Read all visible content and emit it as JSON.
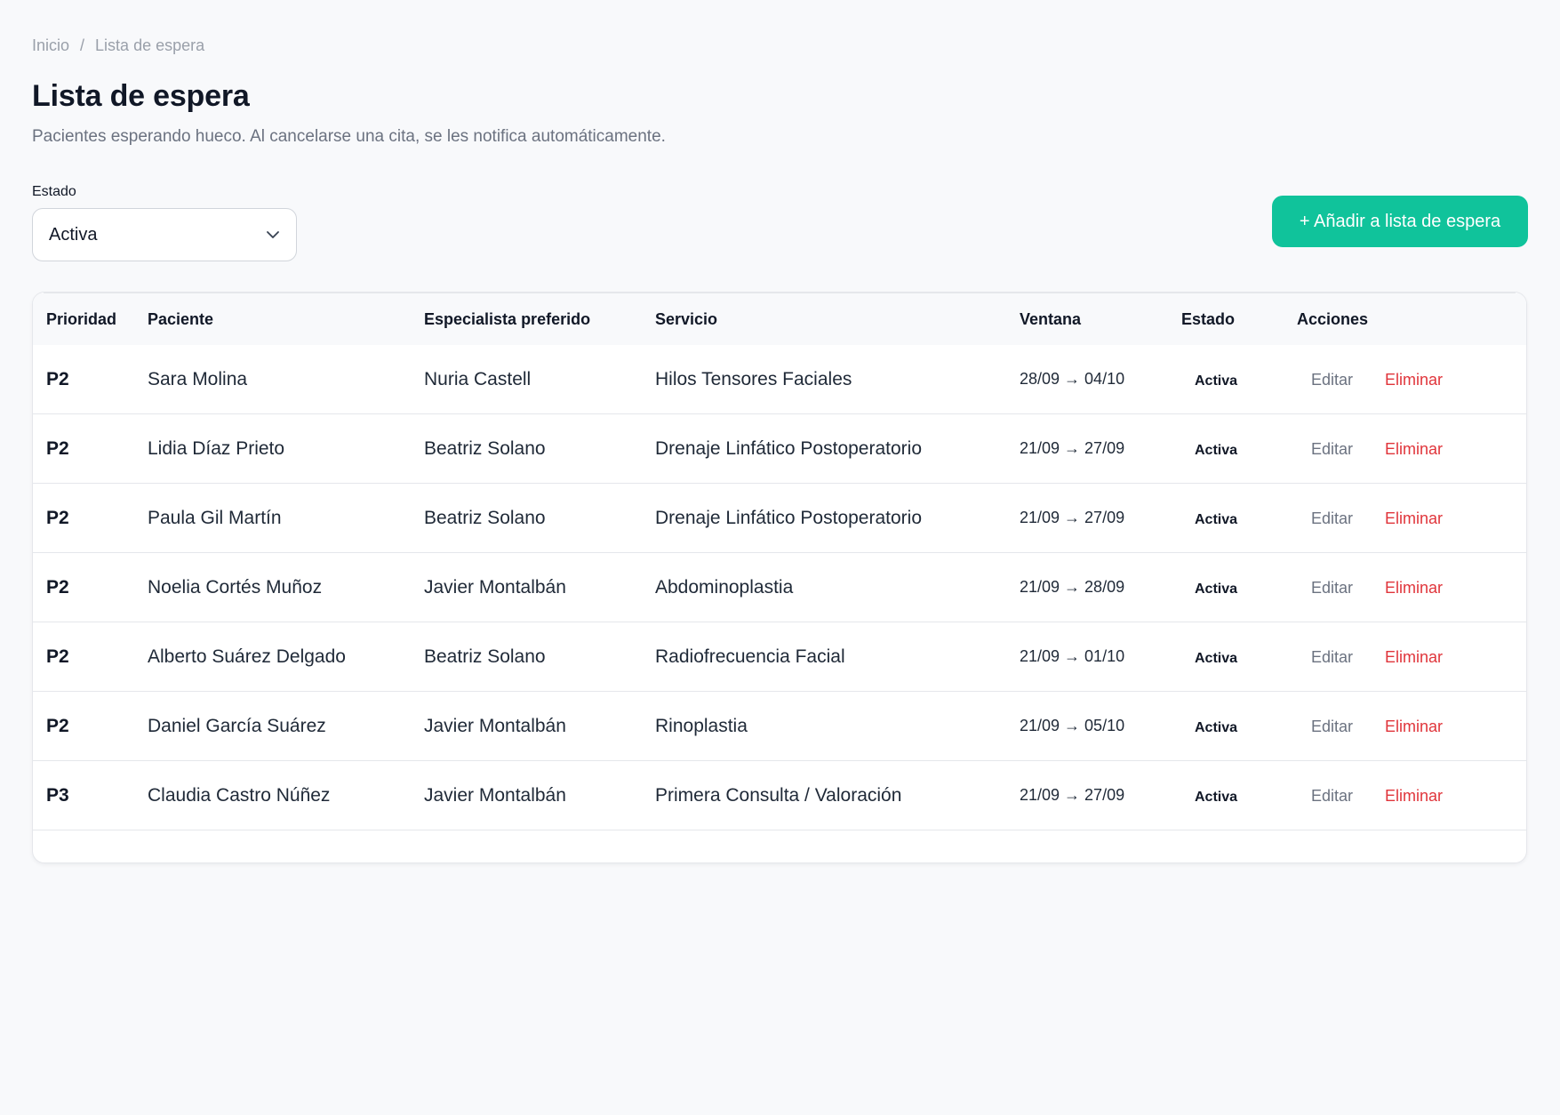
{
  "breadcrumb": {
    "home": "Inicio",
    "separator": "/",
    "current": "Lista de espera"
  },
  "page": {
    "title": "Lista de espera",
    "subtitle": "Pacientes esperando hueco. Al cancelarse una cita, se les notifica automáticamente."
  },
  "filter": {
    "label": "Estado",
    "selected": "Activa",
    "icon": "chevron-down-icon"
  },
  "add_button": {
    "label": "+ Añadir a lista de espera",
    "color": "#10c39b"
  },
  "table": {
    "columns": [
      "Prioridad",
      "Paciente",
      "Especialista preferido",
      "Servicio",
      "Ventana",
      "Estado",
      "Acciones"
    ],
    "rows": [
      {
        "priority": "P2",
        "patient": "Sara Molina",
        "specialist": "Nuria Castell",
        "service": "Hilos Tensores Faciales",
        "window": "28/09 → 04/10",
        "status": "Activa",
        "edit": "Editar",
        "delete": "Eliminar"
      },
      {
        "priority": "P2",
        "patient": "Lidia Díaz Prieto",
        "specialist": "Beatriz Solano",
        "service": "Drenaje Linfático Postoperatorio",
        "window": "21/09 → 27/09",
        "status": "Activa",
        "edit": "Editar",
        "delete": "Eliminar"
      },
      {
        "priority": "P2",
        "patient": "Paula Gil Martín",
        "specialist": "Beatriz Solano",
        "service": "Drenaje Linfático Postoperatorio",
        "window": "21/09 → 27/09",
        "status": "Activa",
        "edit": "Editar",
        "delete": "Eliminar"
      },
      {
        "priority": "P2",
        "patient": "Noelia Cortés Muñoz",
        "specialist": "Javier Montalbán",
        "service": "Abdominoplastia",
        "window": "21/09 → 28/09",
        "status": "Activa",
        "edit": "Editar",
        "delete": "Eliminar"
      },
      {
        "priority": "P2",
        "patient": "Alberto Suárez Delgado",
        "specialist": "Beatriz Solano",
        "service": "Radiofrecuencia Facial",
        "window": "21/09 → 01/10",
        "status": "Activa",
        "edit": "Editar",
        "delete": "Eliminar"
      },
      {
        "priority": "P2",
        "patient": "Daniel García Suárez",
        "specialist": "Javier Montalbán",
        "service": "Rinoplastia",
        "window": "21/09 → 05/10",
        "status": "Activa",
        "edit": "Editar",
        "delete": "Eliminar"
      },
      {
        "priority": "P3",
        "patient": "Claudia Castro Núñez",
        "specialist": "Javier Montalbán",
        "service": "Primera Consulta / Valoración",
        "window": "21/09 → 27/09",
        "status": "Activa",
        "edit": "Editar",
        "delete": "Eliminar"
      }
    ]
  },
  "colors": {
    "accent": "#10c39b",
    "danger": "#e0353b",
    "muted": "#6b7280"
  }
}
